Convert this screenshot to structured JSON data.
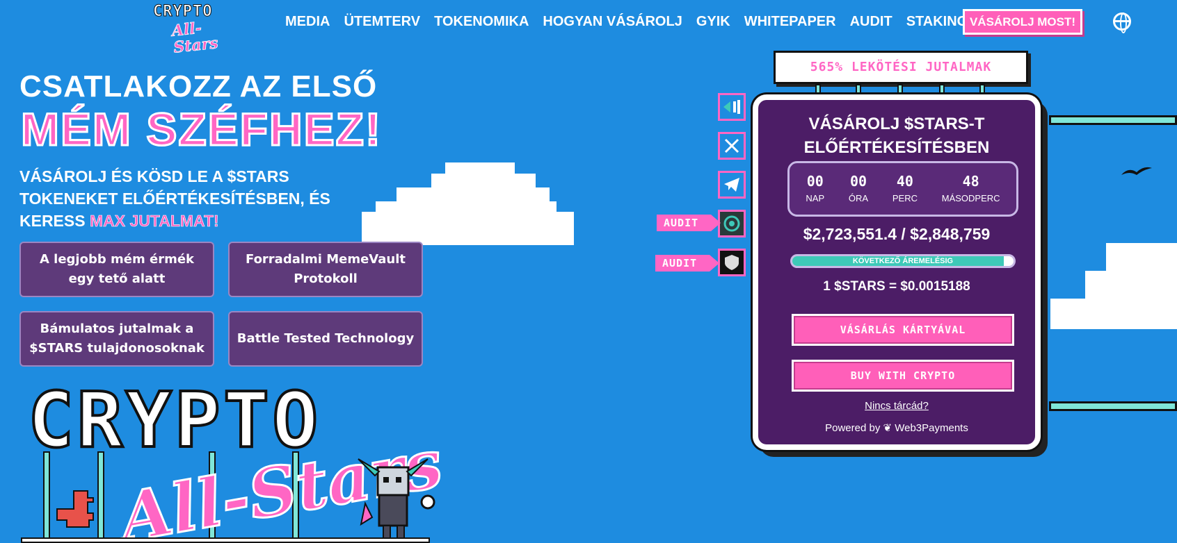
{
  "header": {
    "logo_line1": "CRYPTO",
    "logo_line2": "All-Stars",
    "nav": [
      "MEDIA",
      "ÜTEMTERV",
      "TOKENOMIKA",
      "HOGYAN VÁSÁROLJ",
      "GYIK",
      "WHITEPAPER",
      "AUDIT",
      "STAKING"
    ],
    "cta": "VÁSÁROLJ MOST!",
    "language_icon": "globe-icon"
  },
  "hero": {
    "line1": "CSATLAKOZZ AZ ELSŐ",
    "line2": "MÉM SZÉFHEZ!",
    "sub_text": "VÁSÁROLJ ÉS KÖSD LE A $STARS TOKENEKET ELŐÉRTÉKESÍTÉSBEN, ÉS KERESS",
    "sub_highlight": "MAX JUTALMAT!"
  },
  "features": [
    "A legjobb mém érmék egy tető alatt",
    "Forradalmi MemeVault Protokoll",
    "Bámulatos jutalmak a $STARS tulajdonosoknak",
    "Battle Tested Technology"
  ],
  "big_logo": {
    "line1": "CRYPTO",
    "line2": "All-Stars"
  },
  "social": {
    "icons": [
      "coinmarketcap-icon",
      "x-icon",
      "telegram-icon",
      "audit-coinsult-icon",
      "audit-solidproof-icon"
    ],
    "audit_label": "AUDIT"
  },
  "staking_banner": "565% LEKÖTÉSI JUTALMAK",
  "widget": {
    "title_line1": "VÁSÁROLJ $STARS-T",
    "title_line2": "ELŐÉRTÉKESÍTÉSBEN",
    "countdown": [
      {
        "value": "00",
        "label": "NAP"
      },
      {
        "value": "00",
        "label": "ÓRA"
      },
      {
        "value": "40",
        "label": "PERC"
      },
      {
        "value": "48",
        "label": "MÁSODPERC"
      }
    ],
    "raised": "$2,723,551.4 / $2,848,759",
    "progress_label": "KÖVETKEZŐ ÁREMELÉSIG",
    "progress_fraction": 0.956,
    "price": "1 $STARS = $0.0015188",
    "buy_card": "VÁSÁRLÁS KÁRTYÁVAL",
    "buy_crypto": "BUY WITH CRYPTO",
    "no_wallet": "Nincs tárcád?",
    "powered_by": "Powered by ❦ Web3Payments"
  },
  "colors": {
    "background": "#1e8ce0",
    "pink": "#ff66c4",
    "purple": "#4c1d66",
    "teal": "#3ec9b8"
  }
}
